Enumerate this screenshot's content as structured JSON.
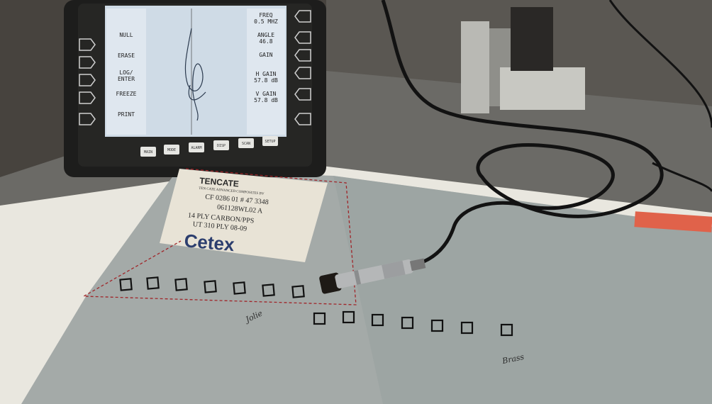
{
  "instrument": {
    "left_menu": [
      "NULL",
      "ERASE",
      "LOG/\nENTER",
      "FREEZE",
      "PRINT"
    ],
    "right_menu": [
      "FREQ\n0.5 MHZ",
      "ANGLE\n46.8",
      "GAIN",
      "H GAIN\n57.8 dB",
      "V GAIN\n57.8 dB"
    ],
    "bottom_buttons": [
      "MAIN",
      "MODE",
      "ALARM",
      "DISP",
      "SCAN",
      "SETUP"
    ]
  },
  "label_card": {
    "brand": "TENCATE",
    "company": "TEN CATE ADVANCED COMPOSITES BV",
    "lot": "CF 0286 01 # 47 3348",
    "code": "061128WL02 A",
    "material": "14 PLY CARBON/PPS",
    "ut": "UT 310 PLY 08-09",
    "product": "Cetex"
  },
  "handwriting": {
    "row1": "Jolie",
    "row2": "Brass"
  },
  "colors": {
    "panel": "#a4aaa8",
    "screen": "#cfdbe6",
    "dashed_outline": "#a0262a"
  }
}
